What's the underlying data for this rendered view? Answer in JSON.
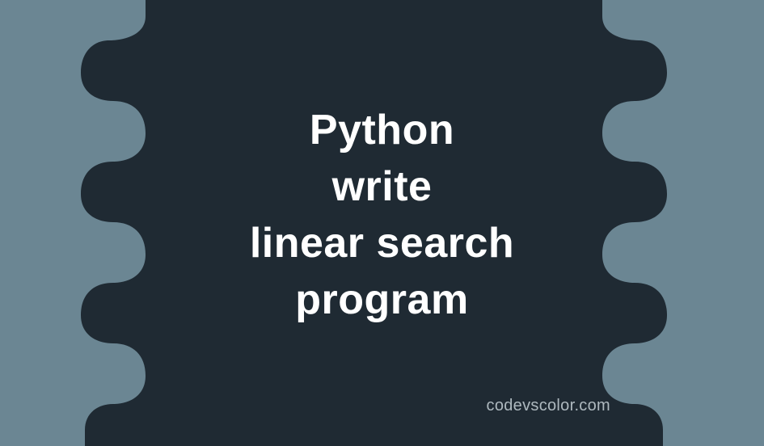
{
  "title": {
    "line1": "Python",
    "line2": "write",
    "line3": "linear search",
    "line4": "program"
  },
  "watermark": "codevscolor.com",
  "colors": {
    "background": "#6b8693",
    "blob": "#1f2a33",
    "text": "#ffffff",
    "watermark": "#aeb9bf"
  }
}
